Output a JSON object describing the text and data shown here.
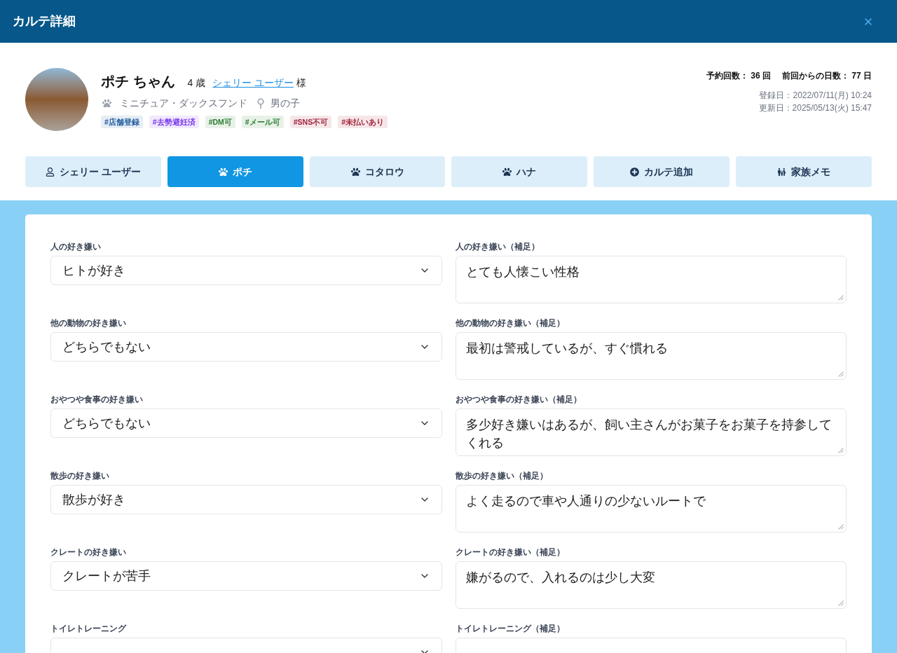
{
  "window": {
    "title": "カルテ詳細"
  },
  "profile": {
    "name": "ポチ ちゃん",
    "age": "4 歳",
    "owner": "シェリー ユーザー",
    "honorific": "様",
    "breed": "ミニチュア・ダックスフンド",
    "sex": "男の子",
    "tags": [
      {
        "label": "#店舗登録",
        "color": "#1d5a9e"
      },
      {
        "label": "#去勢避妊済",
        "color": "#7c3aed"
      },
      {
        "label": "#DM可",
        "color": "#2e7d32"
      },
      {
        "label": "#メール可",
        "color": "#2e7d32"
      },
      {
        "label": "#SNS不可",
        "color": "#a3243b"
      },
      {
        "label": "#未払いあり",
        "color": "#a3243b"
      }
    ]
  },
  "stats": {
    "visits": "予約回数： 36 回",
    "days_since": "前回からの日数： 77 日",
    "registered": "登録日：2022/07/11(月) 10:24",
    "updated": "更新日：2025/05/13(火) 15:47"
  },
  "tabs": [
    {
      "kind": "owner",
      "label": "シェリー ユーザー",
      "selected": false
    },
    {
      "kind": "pet",
      "label": "ポチ",
      "selected": true
    },
    {
      "kind": "pet",
      "label": "コタロウ",
      "selected": false
    },
    {
      "kind": "pet",
      "label": "ハナ",
      "selected": false
    },
    {
      "kind": "add",
      "label": "カルテ追加",
      "selected": false
    },
    {
      "kind": "family",
      "label": "家族メモ",
      "selected": false
    }
  ],
  "form": {
    "rows": [
      {
        "select": {
          "label": "人の好き嫌い",
          "value": "ヒトが好き"
        },
        "note": {
          "label": "人の好き嫌い（補足）",
          "value": "とても人懐こい性格"
        }
      },
      {
        "select": {
          "label": "他の動物の好き嫌い",
          "value": "どちらでもない"
        },
        "note": {
          "label": "他の動物の好き嫌い（補足）",
          "value": "最初は警戒しているが、すぐ慣れる"
        }
      },
      {
        "select": {
          "label": "おやつや食事の好き嫌い",
          "value": "どちらでもない"
        },
        "note": {
          "label": "おやつや食事の好き嫌い（補足）",
          "value": "多少好き嫌いはあるが、飼い主さんがお菓子をお菓子を持参してくれる"
        }
      },
      {
        "select": {
          "label": "散歩の好き嫌い",
          "value": "散歩が好き"
        },
        "note": {
          "label": "散歩の好き嫌い（補足）",
          "value": "よく走るので車や人通りの少ないルートで"
        }
      },
      {
        "select": {
          "label": "クレートの好き嫌い",
          "value": "クレートが苦手"
        },
        "note": {
          "label": "クレートの好き嫌い（補足）",
          "value": "嫌がるので、入れるのは少し大変"
        }
      },
      {
        "select": {
          "label": "トイレトレーニング"
        },
        "note": {
          "label": "トイレトレーニング（補足）"
        }
      }
    ]
  }
}
